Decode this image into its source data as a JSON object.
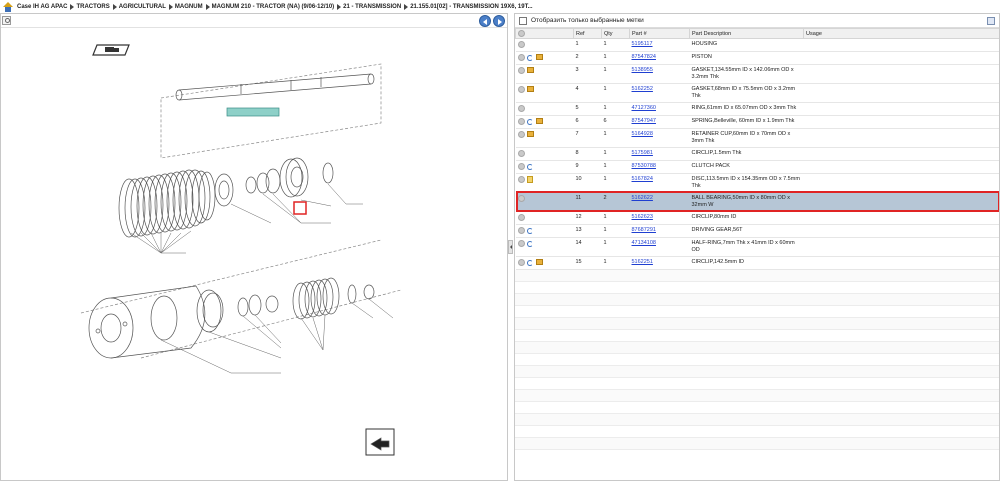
{
  "breadcrumb": [
    "Case IH AG APAC",
    "TRACTORS",
    "AGRICULTURAL",
    "MAGNUM",
    "MAGNUM 210 - TRACTOR (NA) (9/06-12/10)",
    "21 - TRANSMISSION",
    "21.155.01[02] - TRANSMISSION 19X6, 19T..."
  ],
  "filter": {
    "label": "Отобразить только выбранные метки"
  },
  "table": {
    "headers": {
      "ref": "Ref",
      "qty": "Qty",
      "part": "Part #",
      "desc": "Part Description",
      "usage": "Usage"
    },
    "rows": [
      {
        "ref": "1",
        "qty": "1",
        "part": "5195117",
        "desc": "HOUSING",
        "icons": []
      },
      {
        "ref": "2",
        "qty": "1",
        "part": "87547824",
        "desc": "PISTON",
        "icons": [
          "arrow",
          "box"
        ]
      },
      {
        "ref": "3",
        "qty": "1",
        "part": "5138955",
        "desc": "GASKET,134.55mm ID x 142.06mm OD x 3.2mm Thk",
        "icons": [
          "box"
        ]
      },
      {
        "ref": "4",
        "qty": "1",
        "part": "5162252",
        "desc": "GASKET,68mm ID x 75.5mm OD x 3.2mm Thk",
        "icons": [
          "box"
        ]
      },
      {
        "ref": "5",
        "qty": "1",
        "part": "47127360",
        "desc": "RING,61mm ID x 65.07mm OD x 3mm Thk",
        "icons": []
      },
      {
        "ref": "6",
        "qty": "6",
        "part": "87547947",
        "desc": "SPRING,Belleville, 60mm ID x 1.9mm Thk",
        "icons": [
          "arrow",
          "box"
        ]
      },
      {
        "ref": "7",
        "qty": "1",
        "part": "5164928",
        "desc": "RETAINER CUP,60mm ID x 70mm OD x 3mm Thk",
        "icons": [
          "box"
        ]
      },
      {
        "ref": "8",
        "qty": "1",
        "part": "5175981",
        "desc": "CIRCLIP,1.5mm Thk",
        "icons": []
      },
      {
        "ref": "9",
        "qty": "1",
        "part": "87530788",
        "desc": "CLUTCH PACK",
        "icons": [
          "arrow"
        ]
      },
      {
        "ref": "10",
        "qty": "1",
        "part": "5167824",
        "desc": "DISC,113.5mm ID x 154.35mm OD x 7.5mm Thk",
        "icons": [
          "note"
        ]
      },
      {
        "ref": "11",
        "qty": "2",
        "part": "5162622",
        "desc": "BALL BEARING,50mm ID x 80mm OD x 32mm W",
        "icons": [],
        "selected": true
      },
      {
        "ref": "12",
        "qty": "1",
        "part": "5162623",
        "desc": "CIRCLIP,80mm ID",
        "icons": []
      },
      {
        "ref": "13",
        "qty": "1",
        "part": "87687291",
        "desc": "DRIVING GEAR,56T",
        "icons": [
          "arrow"
        ]
      },
      {
        "ref": "14",
        "qty": "1",
        "part": "47134108",
        "desc": "HALF-RING,7mm Thk x 41mm ID x 60mm OD",
        "icons": [
          "arrow"
        ]
      },
      {
        "ref": "15",
        "qty": "1",
        "part": "5162251",
        "desc": "CIRCLIP,142.5mm ID",
        "icons": [
          "arrow",
          "box"
        ]
      }
    ]
  },
  "colors": {
    "link": "#1f3fd1",
    "selected_row": "#b6c6d6",
    "highlight": "#e02424",
    "nav_button": "#4b7fc8"
  },
  "icons": {
    "home": "home-icon",
    "prev": "arrow-left-icon",
    "next": "arrow-right-icon",
    "zoom": "zoom-icon"
  }
}
